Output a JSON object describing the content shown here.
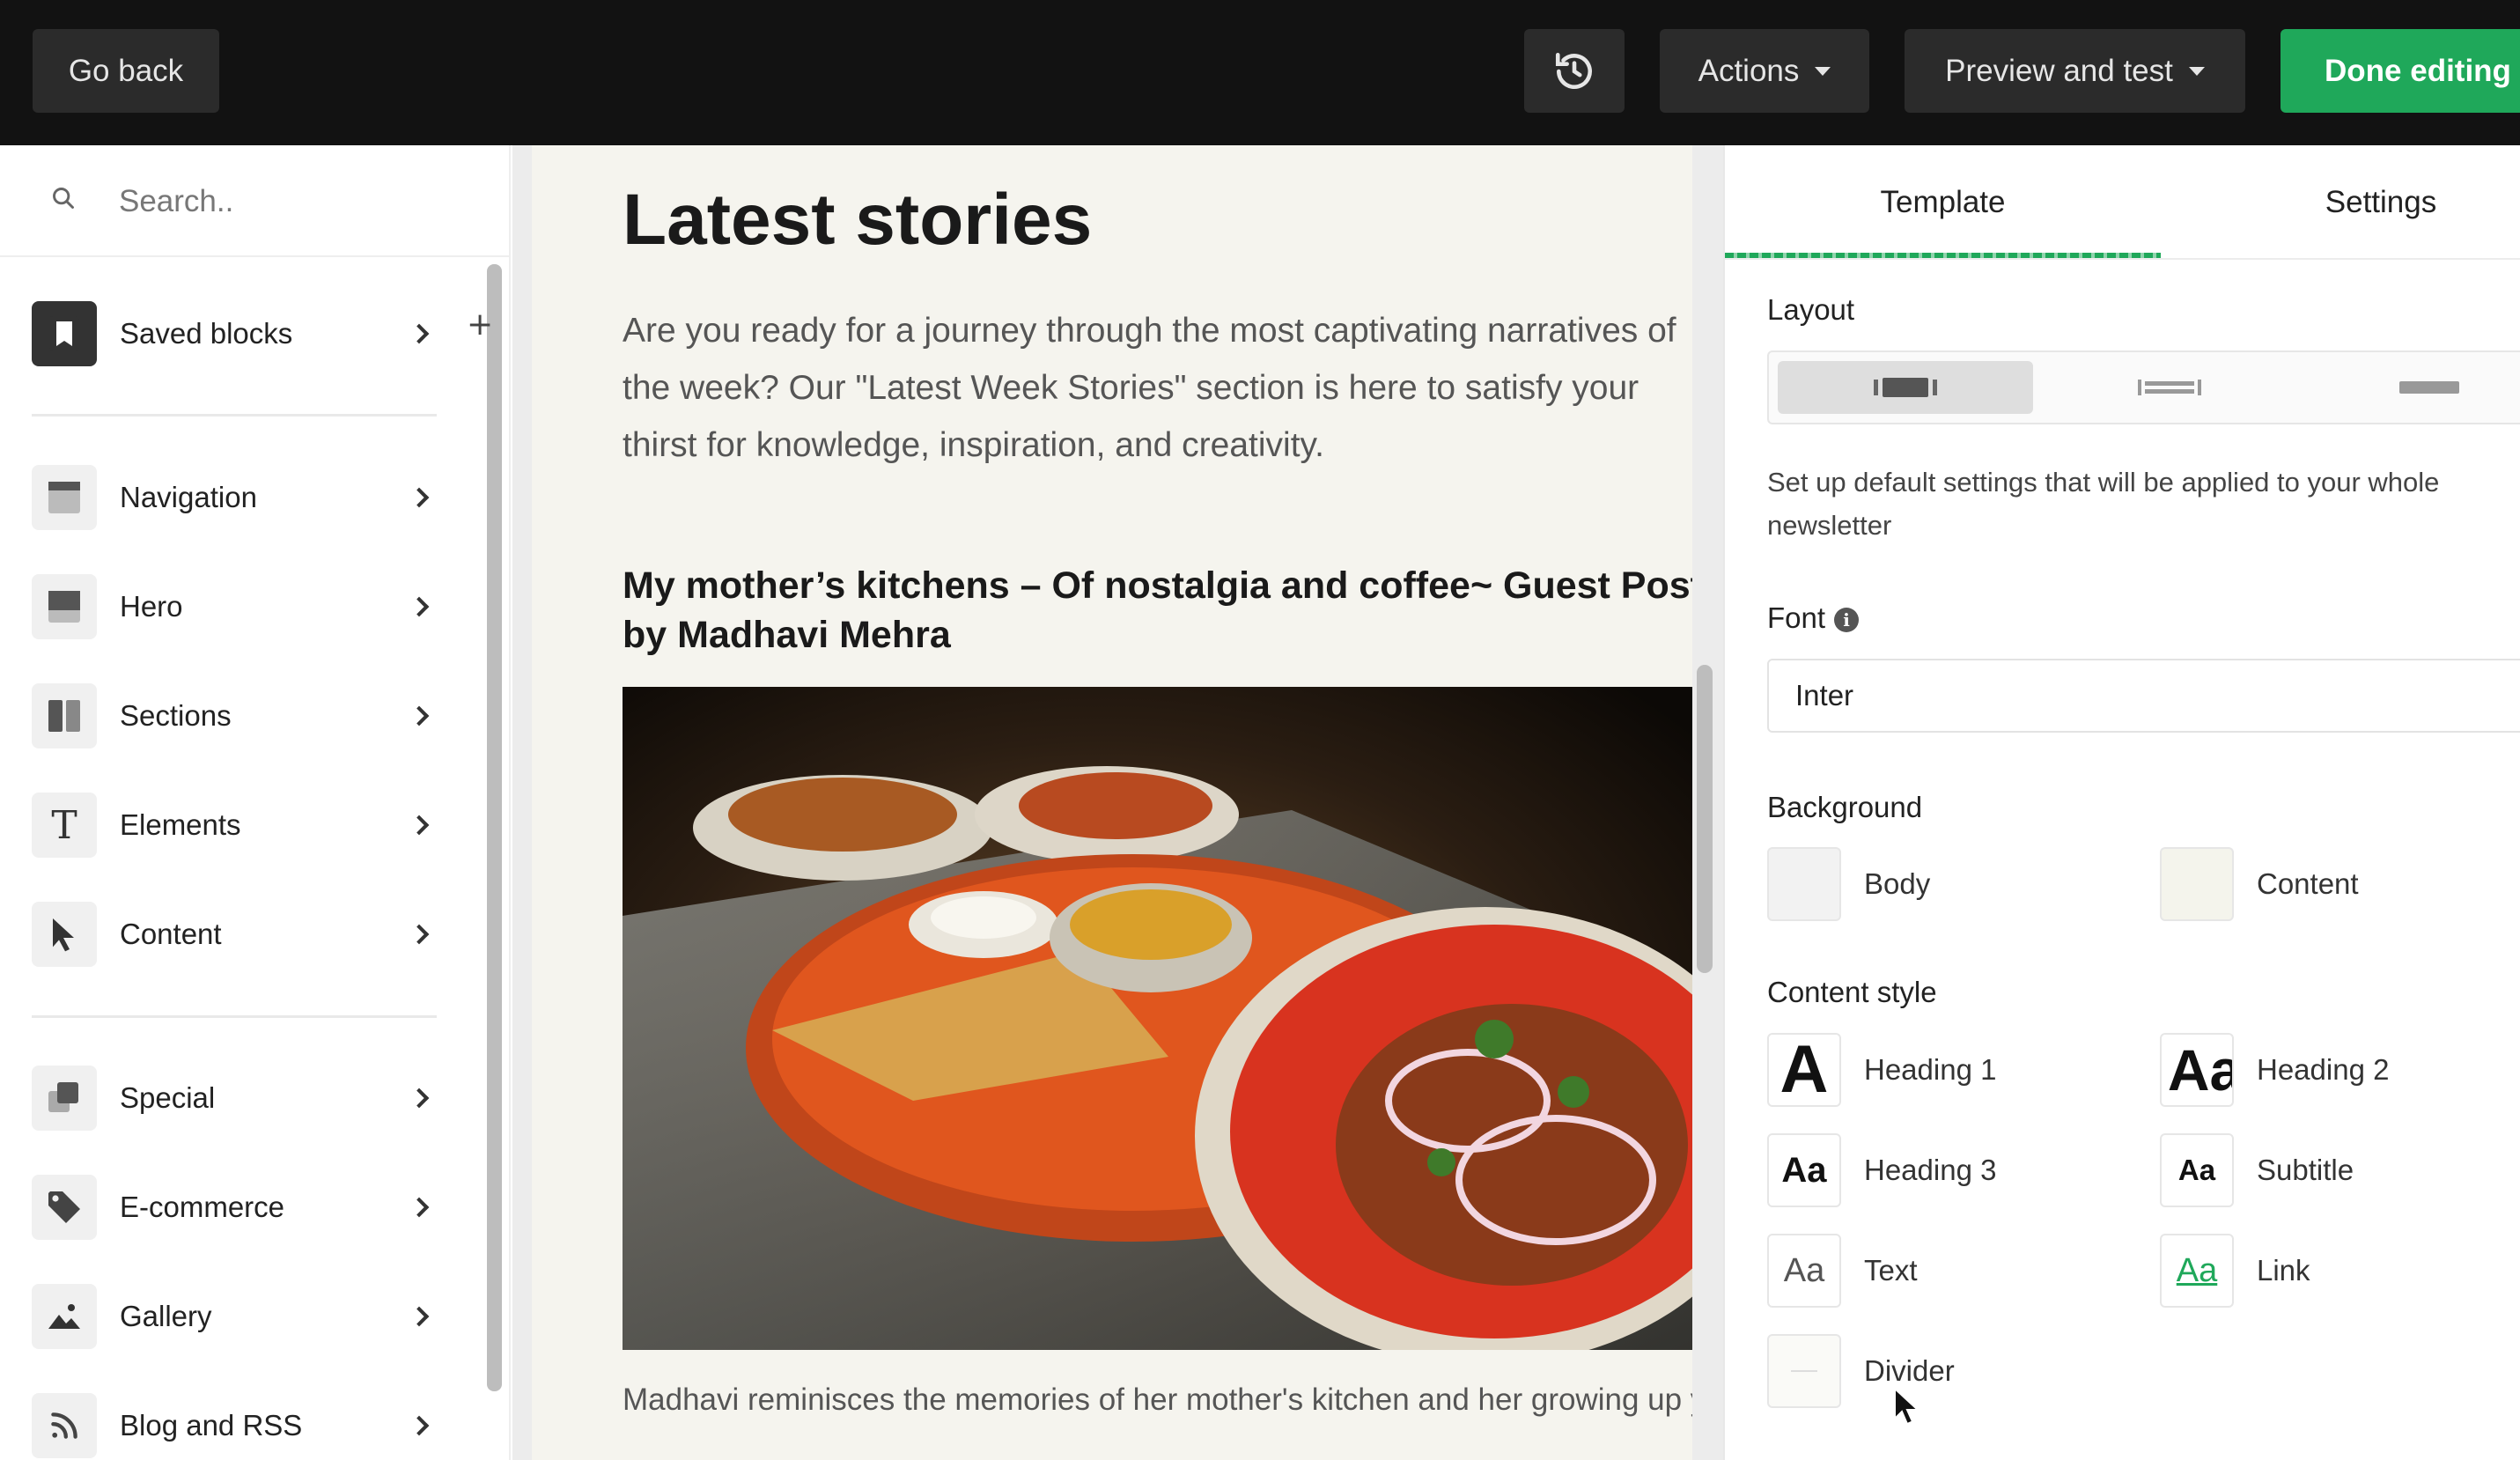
{
  "topbar": {
    "back_label": "Go back",
    "actions_label": "Actions",
    "preview_label": "Preview and test",
    "done_label": "Done editing",
    "icons": {
      "history": "history-icon",
      "caret": "caret-down-icon"
    }
  },
  "sidebar": {
    "search_placeholder": "Search..",
    "items": [
      {
        "label": "Saved blocks",
        "icon": "bookmark-icon"
      },
      {
        "label": "Navigation",
        "icon": "navigation-icon"
      },
      {
        "label": "Hero",
        "icon": "hero-icon"
      },
      {
        "label": "Sections",
        "icon": "sections-icon"
      },
      {
        "label": "Elements",
        "icon": "text-t-icon"
      },
      {
        "label": "Content",
        "icon": "pointer-icon"
      },
      {
        "label": "Special",
        "icon": "special-icon"
      },
      {
        "label": "E-commerce",
        "icon": "tag-icon"
      },
      {
        "label": "Gallery",
        "icon": "image-icon"
      },
      {
        "label": "Blog and RSS",
        "icon": "rss-icon"
      }
    ]
  },
  "preview": {
    "heading": "Latest stories",
    "intro": "Are you ready for a journey through the most captivating narratives of the week? Our \"Latest Week Stories\" section is here to satisfy your thirst for knowledge, inspiration, and creativity.",
    "story_title": "My mother’s kitchens – Of nostalgia and coffee~ Guest Post by Madhavi Mehra",
    "caption": "Madhavi reminisces the memories of her mother's kitchen and her growing up years."
  },
  "panel": {
    "tabs": [
      "Template",
      "Settings"
    ],
    "active_tab": "Template",
    "layout_label": "Layout",
    "layout_options": [
      "layout-boxed",
      "layout-wide",
      "layout-full"
    ],
    "layout_selected": "layout-boxed",
    "layout_note": "Set up default settings that will be applied to your whole newsletter",
    "font_label": "Font",
    "font_value": "Inter",
    "background_label": "Background",
    "background": [
      {
        "label": "Body",
        "color": "#f2f2f2"
      },
      {
        "label": "Content",
        "color": "#f4f4ec"
      }
    ],
    "content_style_label": "Content style",
    "styles": [
      {
        "label": "Heading 1",
        "glyph": "A"
      },
      {
        "label": "Heading 2",
        "glyph": "Aa"
      },
      {
        "label": "Heading 3",
        "glyph": "Aa"
      },
      {
        "label": "Subtitle",
        "glyph": "Aa"
      },
      {
        "label": "Text",
        "glyph": "Aa"
      },
      {
        "label": "Link",
        "glyph": "Aa"
      },
      {
        "label": "Divider",
        "glyph": ""
      }
    ],
    "colors": {
      "accent": "#1fa85a",
      "link": "#1fa85a"
    }
  }
}
